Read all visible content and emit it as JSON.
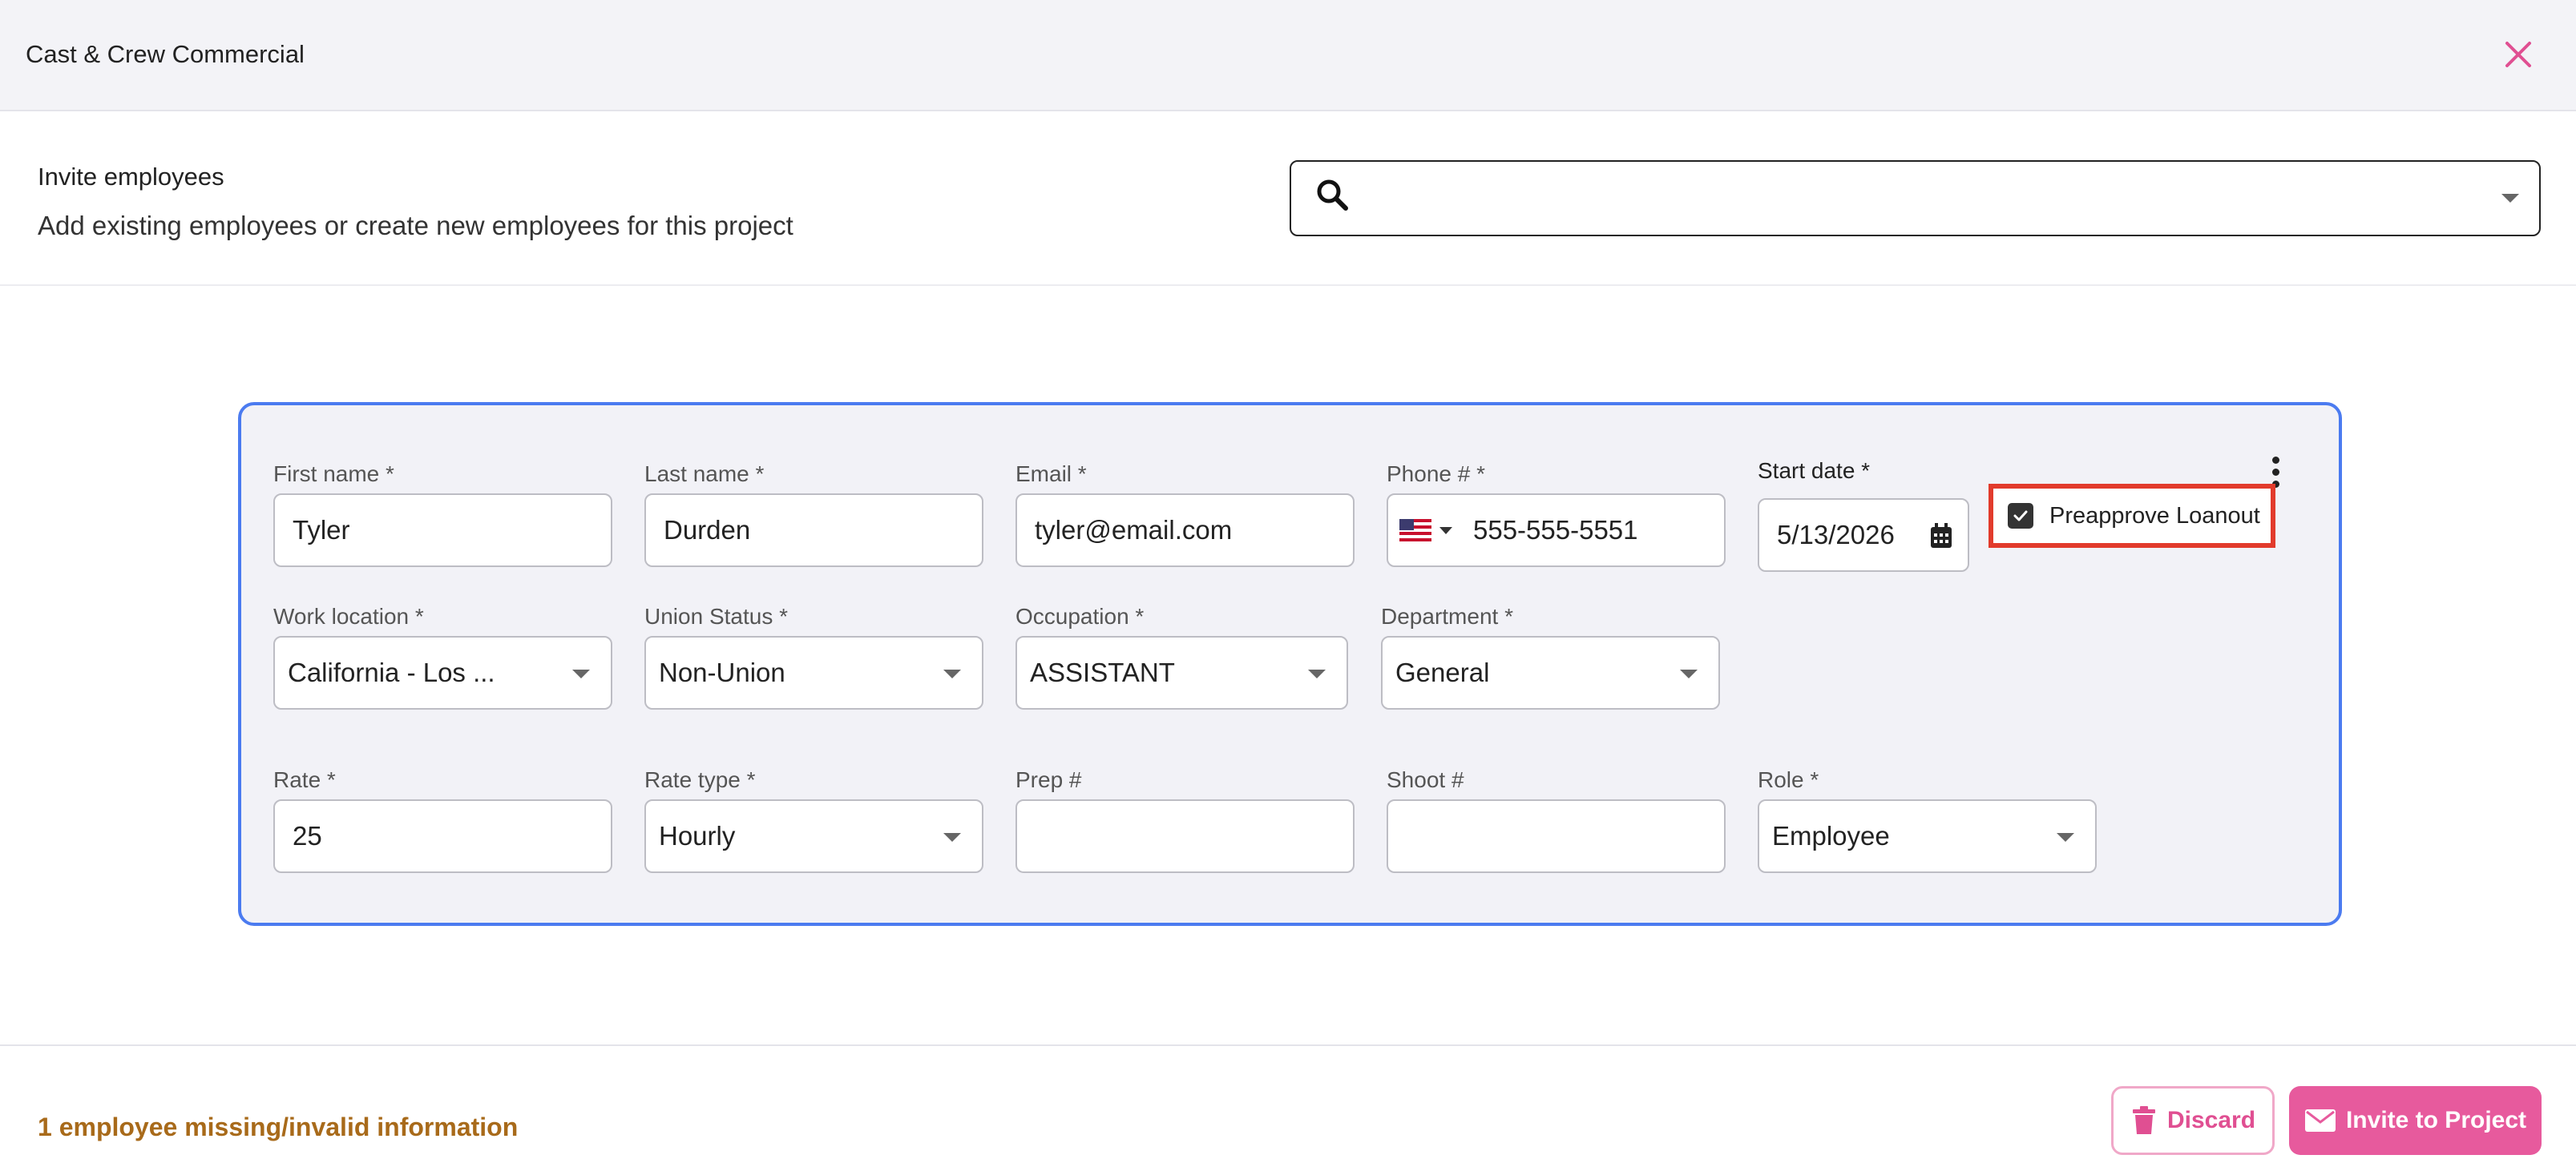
{
  "header": {
    "title": "Cast & Crew Commercial",
    "close_icon": "close-icon"
  },
  "invite": {
    "title": "Invite employees",
    "subtitle": "Add existing employees or create new employees for this project",
    "search_value": ""
  },
  "form": {
    "first_name": {
      "label": "First name *",
      "value": "Tyler"
    },
    "last_name": {
      "label": "Last name *",
      "value": "Durden"
    },
    "email": {
      "label": "Email *",
      "value": "tyler@email.com"
    },
    "phone": {
      "label": "Phone # *",
      "value": "555-555-5551",
      "country_flag": "us-flag-icon"
    },
    "start_date": {
      "label": "Start date *",
      "value": "5/13/2026"
    },
    "preapprove_loanout": {
      "label": "Preapprove Loanout",
      "checked": true
    },
    "work_location": {
      "label": "Work location *",
      "value": "California - Los ..."
    },
    "union_status": {
      "label": "Union Status *",
      "value": "Non-Union"
    },
    "occupation": {
      "label": "Occupation *",
      "value": "ASSISTANT"
    },
    "department": {
      "label": "Department *",
      "value": "General"
    },
    "rate": {
      "label": "Rate *",
      "value": "25"
    },
    "rate_type": {
      "label": "Rate type *",
      "value": "Hourly"
    },
    "prep": {
      "label": "Prep #",
      "value": ""
    },
    "shoot": {
      "label": "Shoot #",
      "value": ""
    },
    "role": {
      "label": "Role *",
      "value": "Employee"
    }
  },
  "footer": {
    "warning": "1 employee missing/invalid information",
    "discard_label": "Discard",
    "invite_label": "Invite to Project"
  },
  "colors": {
    "accent_pink": "#e75a9d",
    "card_border": "#4b7bf0",
    "highlight_red": "#e23b2c",
    "warning_text": "#a86a1a"
  }
}
